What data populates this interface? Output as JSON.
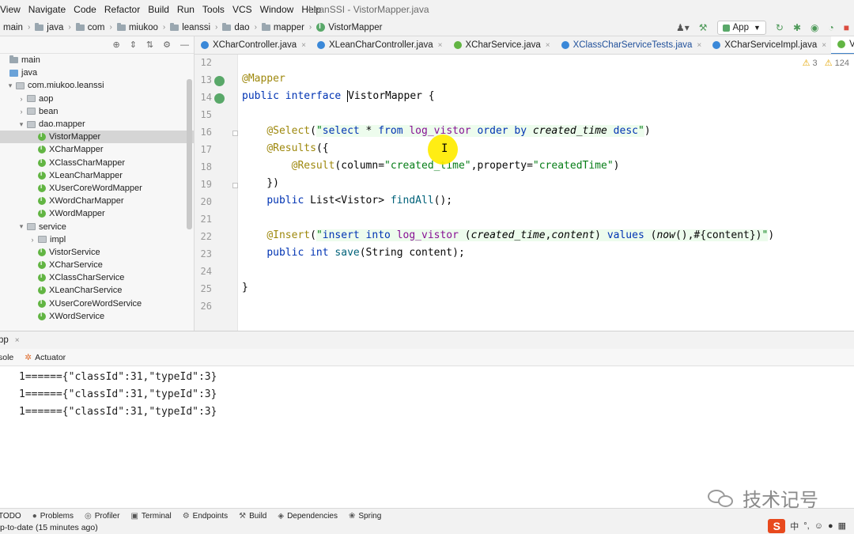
{
  "window": {
    "title": "LeanSSI - VistorMapper.java"
  },
  "menu": [
    "View",
    "Navigate",
    "Code",
    "Refactor",
    "Build",
    "Run",
    "Tools",
    "VCS",
    "Window",
    "Help"
  ],
  "breadcrumb": [
    "main",
    "java",
    "com",
    "miukoo",
    "leanssi",
    "dao",
    "mapper",
    "VistorMapper"
  ],
  "toolbar": {
    "run_config": "App"
  },
  "project_tree": [
    {
      "label": "main",
      "kind": "folder",
      "indent": 0,
      "arrow": ""
    },
    {
      "label": "java",
      "kind": "src",
      "indent": 0,
      "arrow": ""
    },
    {
      "label": "com.miukoo.leanssi",
      "kind": "pkg",
      "indent": 1,
      "arrow": "▾"
    },
    {
      "label": "aop",
      "kind": "pkg",
      "indent": 2,
      "arrow": "›"
    },
    {
      "label": "bean",
      "kind": "pkg",
      "indent": 2,
      "arrow": "›"
    },
    {
      "label": "dao.mapper",
      "kind": "pkg",
      "indent": 2,
      "arrow": "▾"
    },
    {
      "label": "VistorMapper",
      "kind": "iface",
      "indent": 3,
      "arrow": "",
      "selected": true
    },
    {
      "label": "XCharMapper",
      "kind": "iface",
      "indent": 3,
      "arrow": ""
    },
    {
      "label": "XClassCharMapper",
      "kind": "iface",
      "indent": 3,
      "arrow": ""
    },
    {
      "label": "XLeanCharMapper",
      "kind": "iface",
      "indent": 3,
      "arrow": ""
    },
    {
      "label": "XUserCoreWordMapper",
      "kind": "iface",
      "indent": 3,
      "arrow": ""
    },
    {
      "label": "XWordCharMapper",
      "kind": "iface",
      "indent": 3,
      "arrow": ""
    },
    {
      "label": "XWordMapper",
      "kind": "iface",
      "indent": 3,
      "arrow": ""
    },
    {
      "label": "service",
      "kind": "pkg",
      "indent": 2,
      "arrow": "▾"
    },
    {
      "label": "impl",
      "kind": "pkg",
      "indent": 3,
      "arrow": "›"
    },
    {
      "label": "VistorService",
      "kind": "iface",
      "indent": 3,
      "arrow": ""
    },
    {
      "label": "XCharService",
      "kind": "iface",
      "indent": 3,
      "arrow": ""
    },
    {
      "label": "XClassCharService",
      "kind": "iface",
      "indent": 3,
      "arrow": ""
    },
    {
      "label": "XLeanCharService",
      "kind": "iface",
      "indent": 3,
      "arrow": ""
    },
    {
      "label": "XUserCoreWordService",
      "kind": "iface",
      "indent": 3,
      "arrow": ""
    },
    {
      "label": "XWordService",
      "kind": "iface",
      "indent": 3,
      "arrow": ""
    }
  ],
  "tabs": [
    {
      "label": "XCharController.java",
      "color": "#3a88d8",
      "active": false
    },
    {
      "label": "XLeanCharController.java",
      "color": "#3a88d8",
      "active": false
    },
    {
      "label": "XCharService.java",
      "color": "#62b543",
      "active": false
    },
    {
      "label": "XClassCharServiceTests.java",
      "color": "#3a88d8",
      "active": false,
      "highlight": true
    },
    {
      "label": "XCharServiceImpl.java",
      "color": "#3a88d8",
      "active": false
    },
    {
      "label": "VistorMapper.java",
      "color": "#62b543",
      "active": true
    }
  ],
  "editor": {
    "inspection": {
      "warnings": "3",
      "weak": "124"
    },
    "line_numbers": [
      "12",
      "13",
      "14",
      "15",
      "16",
      "17",
      "18",
      "19",
      "20",
      "21",
      "22",
      "23",
      "24",
      "25",
      "26"
    ]
  },
  "run_window": {
    "title": "pp",
    "tabs": [
      "sole",
      "Actuator"
    ],
    "console": [
      "1======{\"classId\":31,\"typeId\":3}",
      "1======{\"classId\":31,\"typeId\":3}",
      "1======{\"classId\":31,\"typeId\":3}"
    ]
  },
  "tool_strip": [
    "TODO",
    "Problems",
    "Profiler",
    "Terminal",
    "Endpoints",
    "Build",
    "Dependencies",
    "Spring"
  ],
  "status": {
    "text": "p-to-date (15 minutes ago)"
  },
  "watermark": {
    "text": "技术记号"
  },
  "ime": {
    "lang": "中"
  }
}
